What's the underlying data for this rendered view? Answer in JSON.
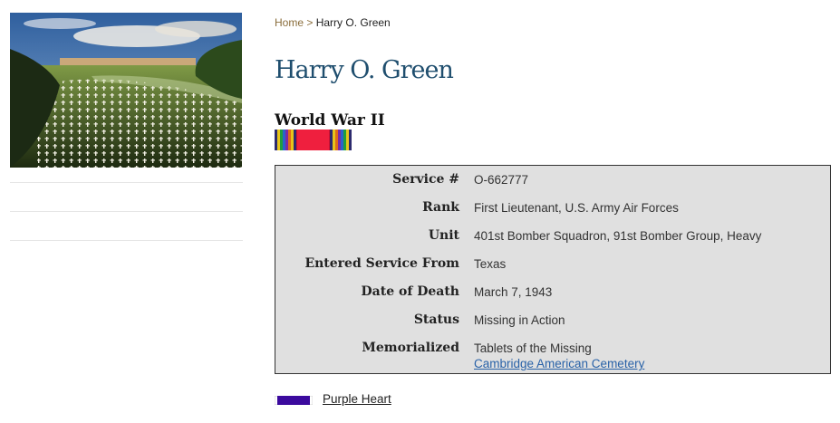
{
  "breadcrumb": {
    "home": "Home",
    "separator": " > ",
    "current": "Harry O. Green"
  },
  "page_title": "Harry O. Green",
  "war": "World War II",
  "details": [
    {
      "label": "Service #",
      "value": "O-662777"
    },
    {
      "label": "Rank",
      "value": "First Lieutenant, U.S. Army Air Forces"
    },
    {
      "label": "Unit",
      "value": "401st Bomber Squadron, 91st Bomber Group, Heavy"
    },
    {
      "label": "Entered Service From",
      "value": "Texas"
    },
    {
      "label": "Date of Death",
      "value": "March 7, 1943"
    },
    {
      "label": "Status",
      "value": "Missing in Action"
    },
    {
      "label": "Memorialized",
      "value": "Tablets of the Missing",
      "link": "Cambridge American Cemetery"
    }
  ],
  "award": {
    "label": "Purple Heart",
    "ribbon_color": "#3b0a9e"
  },
  "colors": {
    "title": "#1f4e6e",
    "link": "#2962a8",
    "breadcrumb_link": "#8a6d3b",
    "infobox_bg": "#e0e0e0"
  }
}
